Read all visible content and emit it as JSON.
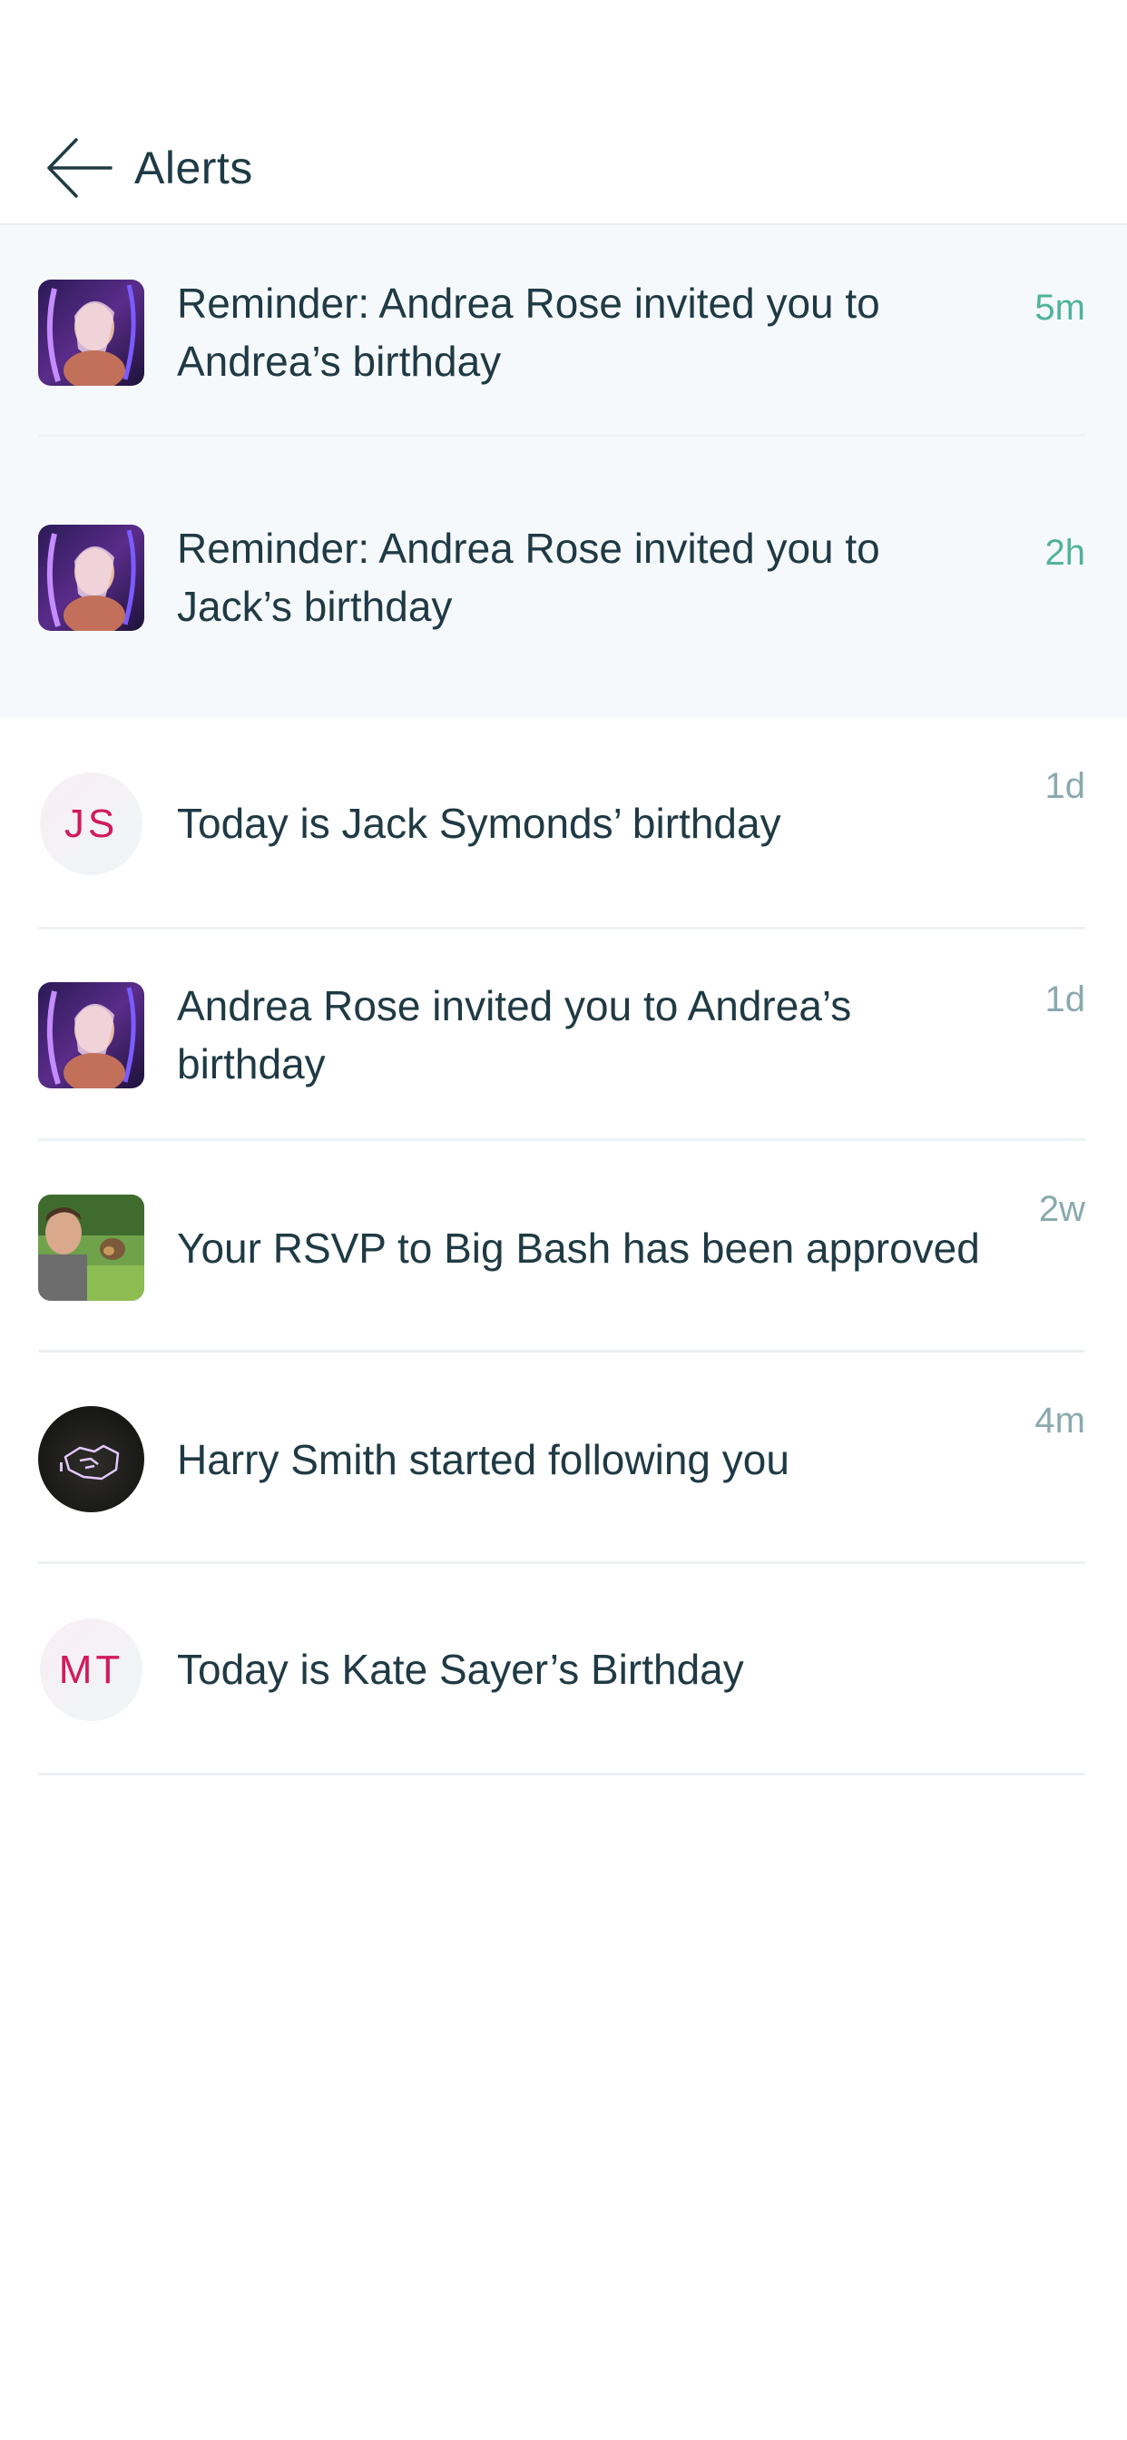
{
  "header": {
    "title": "Alerts",
    "back_icon": "arrow-left-icon"
  },
  "colors": {
    "unread_background": "#f6f9fc",
    "fresh_time": "#4fb39b",
    "old_time": "#8aa9ae",
    "initials": "#d2195e",
    "text": "#1f3a44"
  },
  "alerts": [
    {
      "avatar": "neon-party-photo",
      "message": "Reminder: Andrea Rose invited you to Andrea’s birthday",
      "time": "5m",
      "unread": true
    },
    {
      "avatar": "neon-party-photo",
      "message": "Reminder: Andrea Rose invited you to Jack’s birthday",
      "time": "2h",
      "unread": true
    },
    {
      "avatar_initials": "JS",
      "message": "Today is Jack Symonds’ birthday",
      "time": "1d",
      "unread": false
    },
    {
      "avatar": "neon-party-photo",
      "message": "Andrea Rose invited you to Andrea’s birthday",
      "time": "1d",
      "unread": false
    },
    {
      "avatar": "man-outdoors-photo",
      "message": "Your RSVP to Big Bash has been approved",
      "time": "2w",
      "unread": false
    },
    {
      "avatar": "neon-handshake-photo",
      "message": "Harry Smith started following you",
      "time": "4m",
      "unread": false
    },
    {
      "avatar_initials": "MT",
      "message": "Today is Kate Sayer’s Birthday",
      "time": "",
      "unread": false
    }
  ]
}
